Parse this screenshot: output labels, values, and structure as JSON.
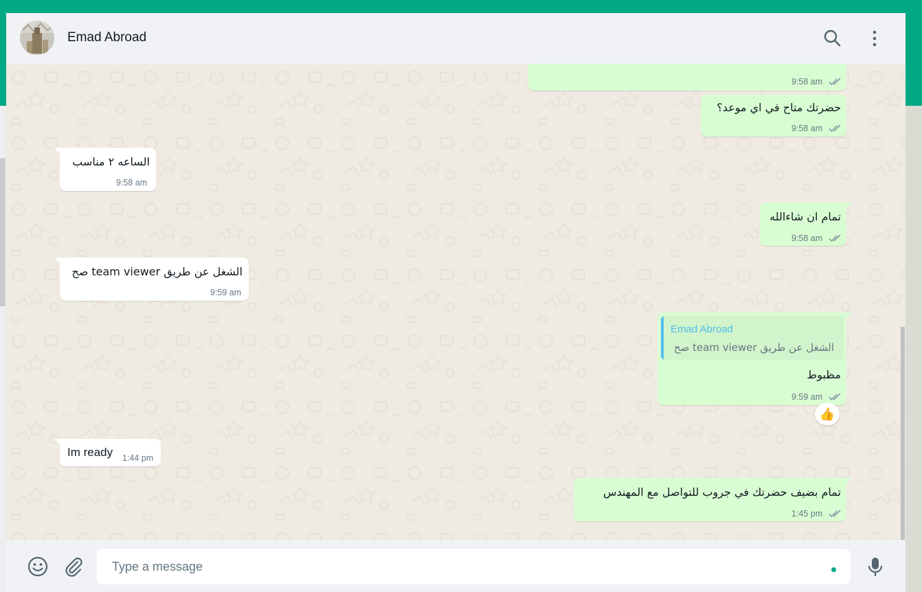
{
  "colors": {
    "brand": "#00a884",
    "outgoing_bubble": "#d9fdd3",
    "incoming_bubble": "#ffffff",
    "quote_author": "#53bdeb",
    "chat_background": "#efeae2"
  },
  "header": {
    "contact_name": "Emad Abroad",
    "icons": [
      "search-icon",
      "menu-icon"
    ]
  },
  "messages": [
    {
      "direction": "out",
      "text": "",
      "time": "9:58 am",
      "status": "read"
    },
    {
      "direction": "out",
      "text": "حضرتك متاح في اي موعد؟",
      "time": "9:58 am",
      "status": "read"
    },
    {
      "direction": "in",
      "text": "الساعه ٢ مناسب",
      "time": "9:58 am"
    },
    {
      "direction": "out",
      "text": "تمام ان شاءالله",
      "time": "9:58 am",
      "status": "read"
    },
    {
      "direction": "in",
      "text": "الشغل عن طريق team viewer صح",
      "time": "9:59 am"
    },
    {
      "direction": "out",
      "quoted": {
        "author": "Emad Abroad",
        "text": "الشغل عن طريق team viewer صح"
      },
      "text": "مظبوط",
      "time": "9:59 am",
      "status": "read",
      "reaction": "👍"
    },
    {
      "direction": "in",
      "text": "Im ready",
      "time": "1:44 pm"
    },
    {
      "direction": "out",
      "text": "تمام بضيف حضرتك في جروب للتواصل مع المهندس",
      "time": "1:45 pm",
      "status": "read"
    }
  ],
  "composer": {
    "placeholder": "Type a message",
    "icons": [
      "emoji-icon",
      "attach-icon",
      "microphone-icon"
    ]
  }
}
